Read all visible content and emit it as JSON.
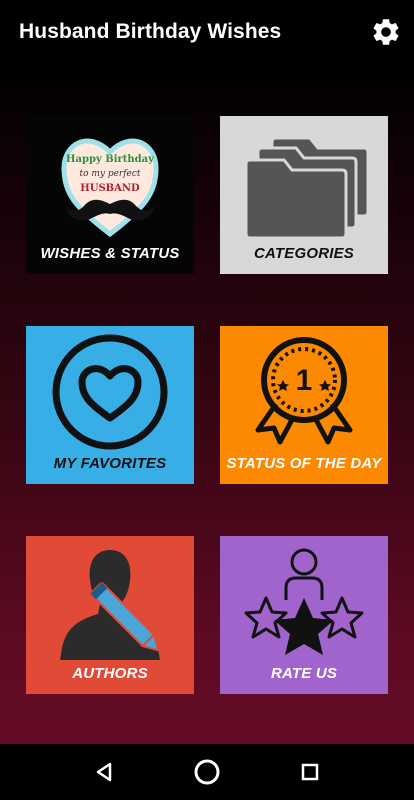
{
  "app": {
    "title": "Husband Birthday Wishes"
  },
  "colors": {
    "wishes": "#050505",
    "categories": "#d8d8d8",
    "favorites": "#37aee6",
    "status_day": "#fb8a02",
    "authors": "#e24a38",
    "rate": "#a163cc"
  },
  "tiles": {
    "wishes": {
      "label": "WISHES & STATUS",
      "icon": "heart-mustache-icon",
      "card_line1": "Happy Birthday",
      "card_line2": "to my perfect",
      "card_line3": "HUSBAND"
    },
    "categories": {
      "label": "CATEGORIES",
      "icon": "folders-icon"
    },
    "favorites": {
      "label": "MY FAVORITES",
      "icon": "heart-circle-icon"
    },
    "status_day": {
      "label": "STATUS OF THE DAY",
      "icon": "award-badge-icon",
      "badge_number": "1"
    },
    "authors": {
      "label": "AUTHORS",
      "icon": "author-pen-icon"
    },
    "rate": {
      "label": "RATE US",
      "icon": "person-stars-icon"
    }
  },
  "navigation": {
    "back": "back-icon",
    "home": "home-icon",
    "recents": "recents-icon"
  }
}
